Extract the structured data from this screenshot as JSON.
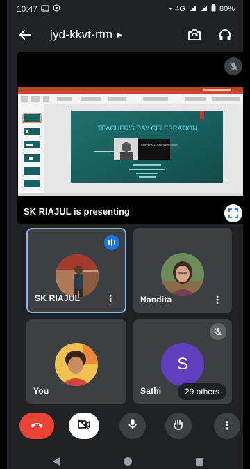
{
  "status_bar": {
    "time": "10:47",
    "network": "4G",
    "battery": "80%"
  },
  "header": {
    "meeting_code": "jyd-kkvt-rtm"
  },
  "presentation": {
    "label": "SK RIAJUL is presenting",
    "slide_title": "TEACHER'S DAY CELEBRATION",
    "slide_name_text": "SARVEPALLI RADHAKRISHNAN"
  },
  "participants": [
    {
      "name": "SK RIAJUL",
      "speaking": true
    },
    {
      "name": "Nandita"
    },
    {
      "name": "You"
    },
    {
      "name": "Sathi",
      "initial": "S",
      "muted": true
    }
  ],
  "others": {
    "label": "29 others"
  },
  "colors": {
    "end_call": "#ea4335",
    "active_border": "#8ab4f8",
    "speaking_badge": "#1a73e8",
    "avatar_letter_bg": "#5d3fbf",
    "tile_bg": "#3c4043",
    "app_bg": "#202124"
  },
  "icons": {
    "back": "arrow-left-icon",
    "switch_camera": "switch-camera-icon",
    "audio": "headphones-icon",
    "present_mute": "mic-off-icon",
    "fullscreen": "fullscreen-icon",
    "end_call": "phone-hangup-icon",
    "camera": "camera-off-icon",
    "mic": "mic-icon",
    "raise_hand": "raise-hand-icon",
    "more": "more-vertical-icon"
  }
}
